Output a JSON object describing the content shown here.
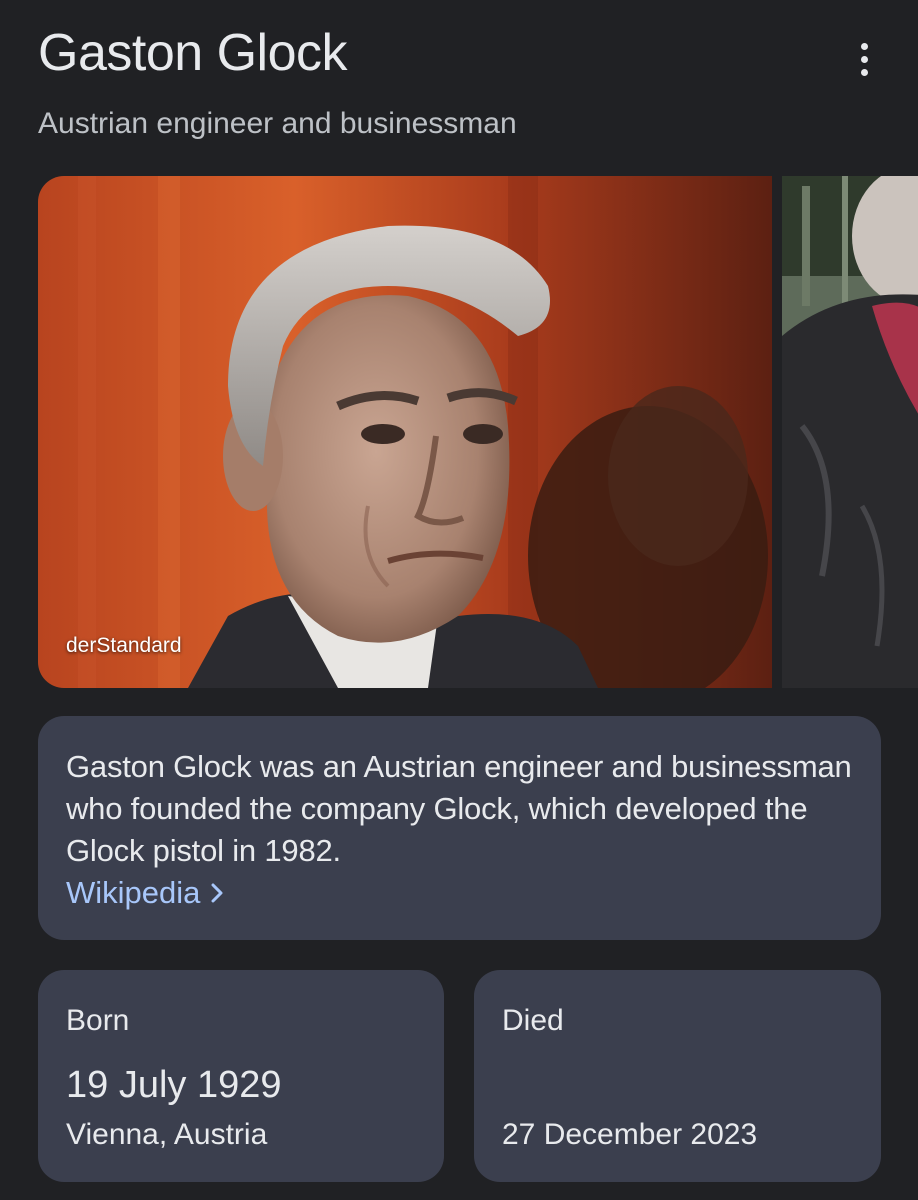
{
  "header": {
    "title": "Gaston Glock",
    "subtitle": "Austrian engineer and businessman",
    "more_icon": "more-vert-icon"
  },
  "gallery": {
    "images": [
      {
        "source": "derStandard"
      },
      {
        "source": ""
      }
    ]
  },
  "description": {
    "text": "Gaston Glock was an Austrian engineer and businessman who founded the company Glock, which developed the Glock pistol in 1982.",
    "link_label": "Wikipedia",
    "link_icon": "chevron-right-icon"
  },
  "facts": {
    "born": {
      "label": "Born",
      "date": "19 July 1929",
      "place": "Vienna, Austria"
    },
    "died": {
      "label": "Died",
      "date": "27 December 2023"
    }
  },
  "colors": {
    "background": "#202124",
    "card": "#3b3f4e",
    "link": "#a8c7fa",
    "text": "#e8eaed",
    "subtext": "#bdc1c6"
  }
}
